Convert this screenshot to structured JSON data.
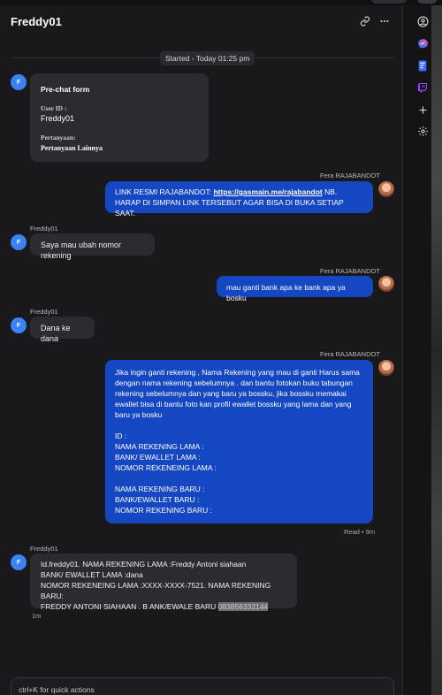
{
  "header": {
    "title": "Freddy01"
  },
  "conversation": {
    "started": "Started - Today 01:25 pm",
    "form": {
      "title": "Pre-chat form",
      "label_user_id": "User ID :",
      "value_user_id": "Freddy01",
      "label_question": "Pertanyaan:",
      "value_question": "Pertanyaan Lainnya"
    },
    "visitor_name": "Freddy01",
    "visitor_initial": "F",
    "agent_name": "Fera RAJABANDOT",
    "msg1_prefix": "LINK RESMI RAJABANDOT: ",
    "msg1_link": "https://gasmain.me/rajabandot",
    "msg1_suffix": " NB. HARAP DI SIMPAN LINK TERSEBUT AGAR BISA DI BUKA SETIAP SAAT.",
    "msg2": "Saya mau ubah nomor rekening",
    "msg3": "mau ganti bank apa ke bank apa ya bosku",
    "msg4": "Dana ke dana",
    "msg5": "Jika ingin ganti rekening , Nama Rekening yang mau di ganti Harus sama dengan nama rekening sebelumnya . dan bantu fotokan buku tabungan rekening sebelumnya dan yang baru ya bossku, jika bossku memakai ewallet bisa di bantu foto kan profil ewallet bossku yang lama dan yang baru ya bosku\n\nID :\nNAMA REKENING LAMA :\nBANK/ EWALLET LAMA :\nNOMOR REKENEING LAMA :\n\nNAMA REKENING BARU :\nBANK/EWALLET BARU :\nNOMOR REKENING BARU :",
    "msg5_status": "Read • 9m",
    "msg6_text": "Id.freddy01. NAMA REKENING LAMA :Freddy Antoni siahaan\nBANK/ EWALLET LAMA :dana\nNOMOR REKENEING LAMA :XXXX-XXXX-7521. NAMA REKENING BARU:\nFREDDY ANTONI SIAHAAN . B ANK/EWALE BARU ",
    "msg6_highlight": "083856332144",
    "msg6_time": "1m"
  },
  "input": {
    "placeholder": "ctrl+K for quick actions"
  },
  "icons": {
    "header": [
      "link-icon",
      "more-icon"
    ],
    "sidebar": [
      "account-icon",
      "messenger-icon",
      "notes-icon",
      "twitch-icon",
      "add-icon",
      "settings-icon"
    ]
  },
  "colors": {
    "accent": "#3b82f6",
    "agent_bubble": "#1547c2",
    "visitor_bubble": "#2b2b30",
    "messenger": "#a855f7",
    "twitch": "#9146ff"
  }
}
